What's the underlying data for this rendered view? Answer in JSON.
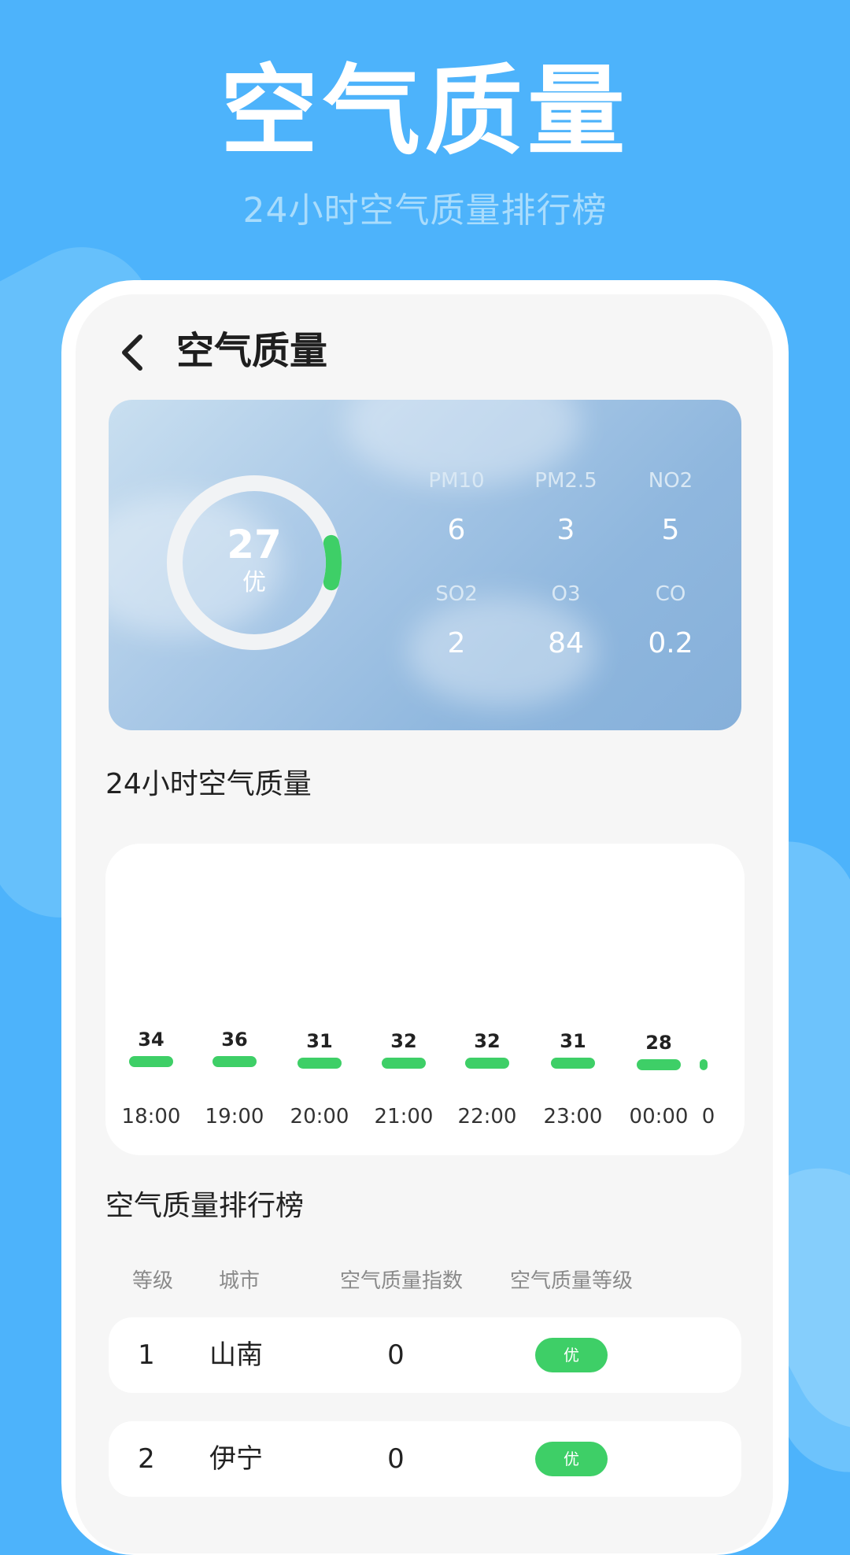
{
  "promo": {
    "title": "空气质量",
    "subtitle": "24小时空气质量排行榜"
  },
  "header": {
    "back_icon": "chevron-left-icon",
    "title": "空气质量"
  },
  "aqi_card": {
    "aqi_value": "27",
    "aqi_level": "优",
    "gauge_fraction": 0.08,
    "gauge_color": "#3ecf67",
    "pollutants": [
      {
        "label": "PM10",
        "value": "6"
      },
      {
        "label": "PM2.5",
        "value": "3"
      },
      {
        "label": "NO2",
        "value": "5"
      },
      {
        "label": "SO2",
        "value": "2"
      },
      {
        "label": "O3",
        "value": "84"
      },
      {
        "label": "CO",
        "value": "0.2"
      }
    ]
  },
  "hourly": {
    "title": "24小时空气质量",
    "items": [
      {
        "value": "34",
        "time": "18:00"
      },
      {
        "value": "36",
        "time": "19:00"
      },
      {
        "value": "31",
        "time": "20:00"
      },
      {
        "value": "32",
        "time": "21:00"
      },
      {
        "value": "32",
        "time": "22:00"
      },
      {
        "value": "31",
        "time": "23:00"
      },
      {
        "value": "28",
        "time": "00:00"
      },
      {
        "value": "",
        "time": "0"
      }
    ]
  },
  "ranking": {
    "title": "空气质量排行榜",
    "columns": {
      "rank": "等级",
      "city": "城市",
      "index": "空气质量指数",
      "level": "空气质量等级"
    },
    "rows": [
      {
        "rank": "1",
        "city": "山南",
        "index": "0",
        "level": "优"
      },
      {
        "rank": "2",
        "city": "伊宁",
        "index": "0",
        "level": "优"
      }
    ]
  },
  "colors": {
    "background": "#4db3fb",
    "good": "#3ecf67"
  }
}
